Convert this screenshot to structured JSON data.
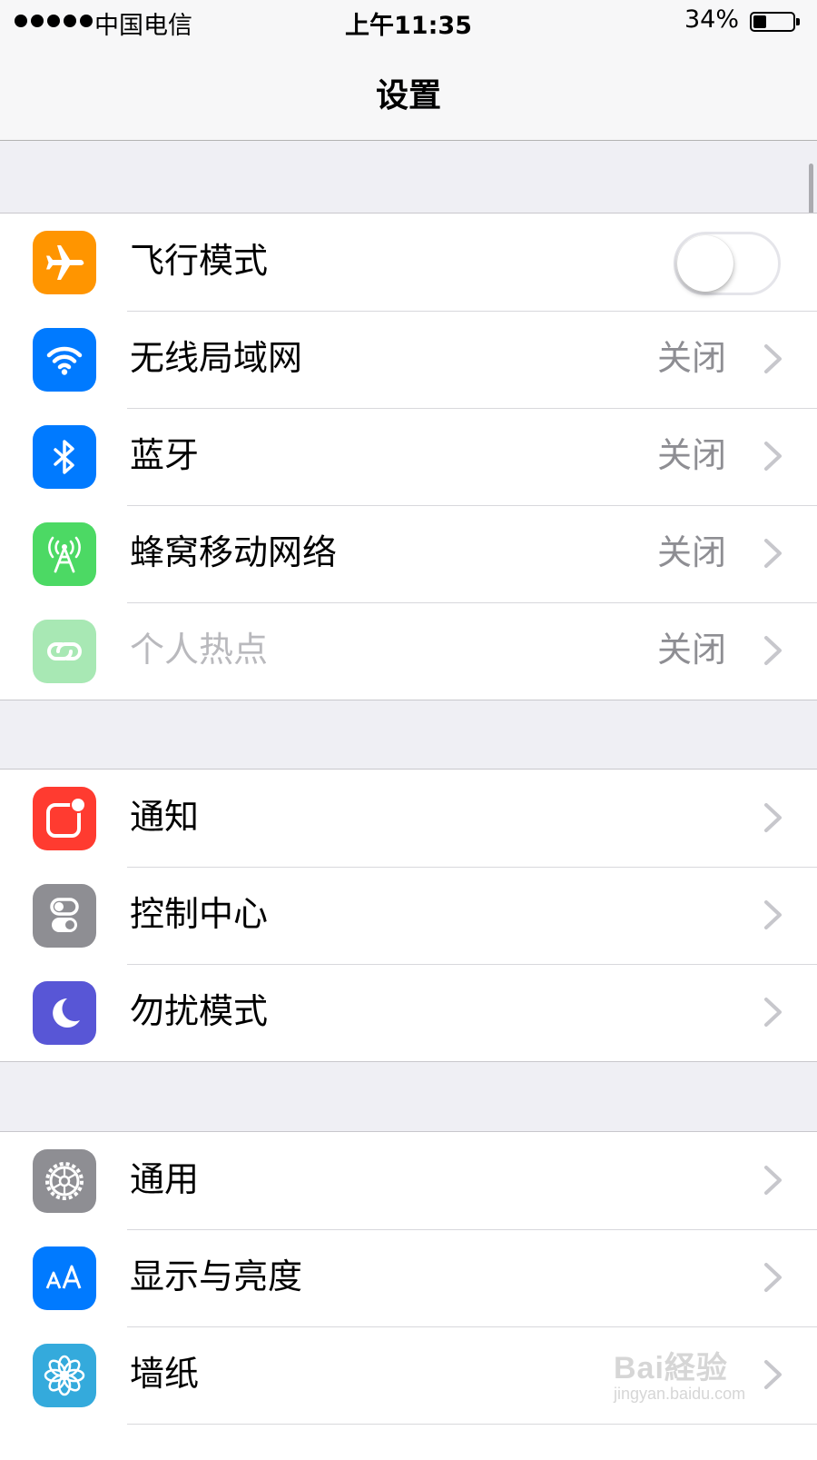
{
  "status_bar": {
    "carrier": "中国电信",
    "time": "上午11:35",
    "battery_percent": "34%",
    "battery_level": 0.34
  },
  "nav": {
    "title": "设置"
  },
  "groups": [
    [
      {
        "label": "飞行模式",
        "icon": "airplane-icon",
        "color": "#ff9500",
        "control": "toggle",
        "toggle_on": false
      },
      {
        "label": "无线局域网",
        "icon": "wifi-icon",
        "color": "#007aff",
        "value": "关闭"
      },
      {
        "label": "蓝牙",
        "icon": "bluetooth-icon",
        "color": "#007aff",
        "value": "关闭"
      },
      {
        "label": "蜂窝移动网络",
        "icon": "cellular-antenna-icon",
        "color": "#4cd964",
        "value": "关闭"
      },
      {
        "label": "个人热点",
        "icon": "hotspot-chain-icon",
        "color": "#a8e8b4",
        "value": "关闭",
        "disabled": true
      }
    ],
    [
      {
        "label": "通知",
        "icon": "notifications-icon",
        "color": "#ff3b30"
      },
      {
        "label": "控制中心",
        "icon": "control-center-icon",
        "color": "#8e8e93"
      },
      {
        "label": "勿扰模式",
        "icon": "moon-icon",
        "color": "#5856d6"
      }
    ],
    [
      {
        "label": "通用",
        "icon": "gear-icon",
        "color": "#8e8e93"
      },
      {
        "label": "显示与亮度",
        "icon": "text-size-aa-icon",
        "color": "#007aff"
      },
      {
        "label": "墙纸",
        "icon": "flower-icon",
        "color": "#34aadc"
      }
    ]
  ],
  "watermark": {
    "brand": "Bai経验",
    "site": "jingyan.baidu.com"
  }
}
